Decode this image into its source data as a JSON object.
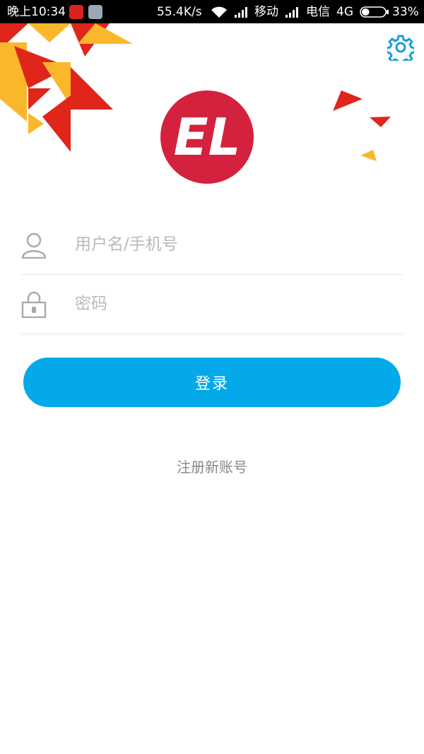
{
  "status_bar": {
    "time": "晚上10:34",
    "speed": "55.4K/s",
    "carrier1": "移动",
    "carrier2": "电信",
    "network": "4G",
    "battery": "33%",
    "battery_level": 0.33
  },
  "header": {
    "settings_icon": "gear-icon",
    "logo_text": "EL"
  },
  "form": {
    "username": {
      "value": "",
      "placeholder": "用户名/手机号",
      "icon": "user-icon"
    },
    "password": {
      "value": "",
      "placeholder": "密码",
      "icon": "lock-icon"
    },
    "login_label": "登录"
  },
  "footer": {
    "register_label": "注册新账号"
  },
  "colors": {
    "accent": "#03a9e8",
    "logo_red": "#d4213d",
    "decor_red": "#e0251b",
    "decor_yellow": "#fbb72c"
  }
}
